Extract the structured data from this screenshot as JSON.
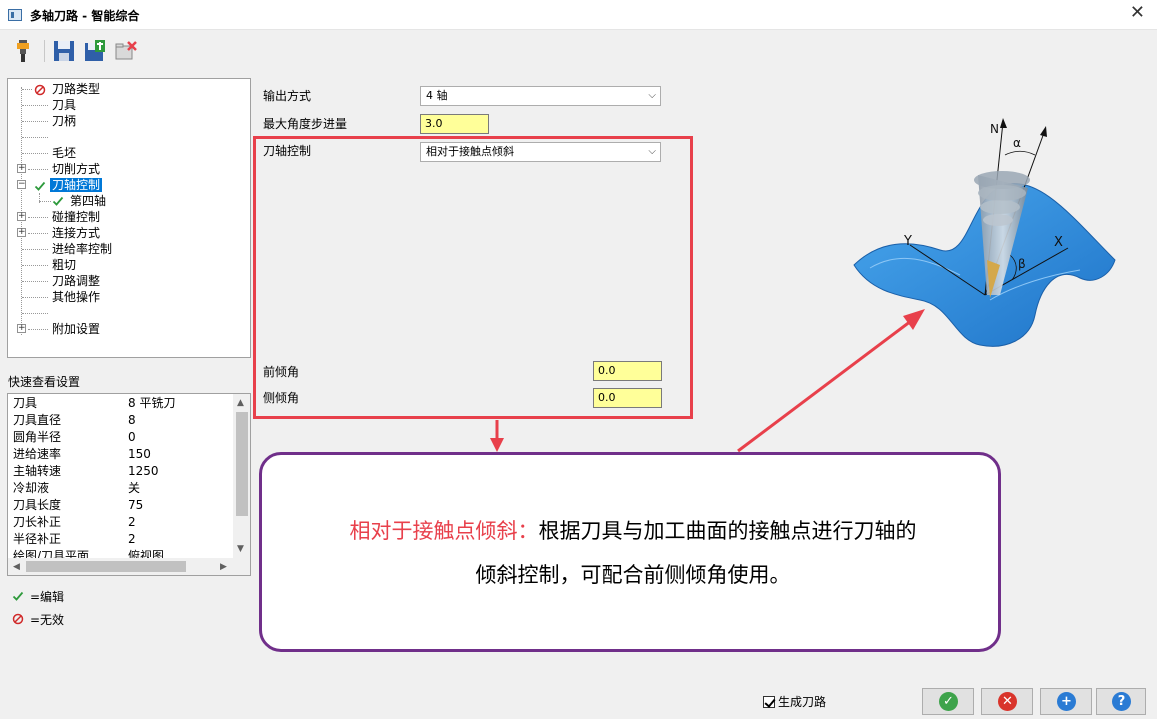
{
  "window": {
    "title": "多轴刀路 - 智能综合",
    "close_glyph": "✕"
  },
  "toolbar": {
    "tools": [
      {
        "name": "tool-holder-icon"
      },
      {
        "name": "save-icon"
      },
      {
        "name": "save-export-icon"
      },
      {
        "name": "delete-icon"
      }
    ]
  },
  "tree": {
    "items": [
      {
        "label": "刀路类型",
        "status": "invalid"
      },
      {
        "label": "刀具"
      },
      {
        "label": "刀柄"
      },
      {
        "label": ""
      },
      {
        "label": "毛坯"
      },
      {
        "label": "切削方式",
        "expandable": true
      },
      {
        "label": "刀轴控制",
        "expandable": true,
        "expanded": true,
        "status": "edited",
        "selected": true
      },
      {
        "label": "第四轴",
        "status": "edited",
        "child": true
      },
      {
        "label": "碰撞控制",
        "expandable": true
      },
      {
        "label": "连接方式",
        "expandable": true
      },
      {
        "label": "进给率控制"
      },
      {
        "label": "粗切"
      },
      {
        "label": "刀路调整"
      },
      {
        "label": "其他操作"
      },
      {
        "label": ""
      },
      {
        "label": "附加设置",
        "expandable": true
      }
    ]
  },
  "quick_view": {
    "label": "快速查看设置",
    "rows": [
      {
        "key": "刀具",
        "value": "8 平铣刀"
      },
      {
        "key": "刀具直径",
        "value": "8"
      },
      {
        "key": "圆角半径",
        "value": "0"
      },
      {
        "key": "进给速率",
        "value": "150"
      },
      {
        "key": "主轴转速",
        "value": "1250"
      },
      {
        "key": "冷却液",
        "value": "关"
      },
      {
        "key": "刀具长度",
        "value": "75"
      },
      {
        "key": "刀长补正",
        "value": "2"
      },
      {
        "key": "半径补正",
        "value": "2"
      },
      {
        "key": "绘图/刀具平面",
        "value": "俯视图"
      }
    ]
  },
  "legend": {
    "edited": "=编辑",
    "invalid": "=无效"
  },
  "form": {
    "output_label": "输出方式",
    "output_value": "4 轴",
    "max_angle_label": "最大角度步进量",
    "max_angle_value": "3.0",
    "axis_control_label": "刀轴控制",
    "axis_control_value": "相对于接触点倾斜",
    "lead_angle_label": "前倾角",
    "lead_angle_value": "0.0",
    "side_angle_label": "侧倾角",
    "side_angle_value": "0.0"
  },
  "diagram": {
    "n_label": "N",
    "alpha_label": "α",
    "beta_label": "β",
    "x_label": "X",
    "y_label": "Y"
  },
  "callout": {
    "highlight": "相对于接触点倾斜：",
    "line1_rest": "根据刀具与加工曲面的接触点进行刀轴的",
    "line2": "倾斜控制，可配合前侧倾角使用。"
  },
  "footer": {
    "generate_label": "生成刀路",
    "ok_glyph": "✓",
    "cancel_glyph": "✕",
    "add_glyph": "+",
    "help_glyph": "?"
  },
  "colors": {
    "accent": "#0078d7",
    "highlight_red": "#e8404b",
    "callout_border": "#702f8a",
    "input_yellow": "#ffff99"
  }
}
